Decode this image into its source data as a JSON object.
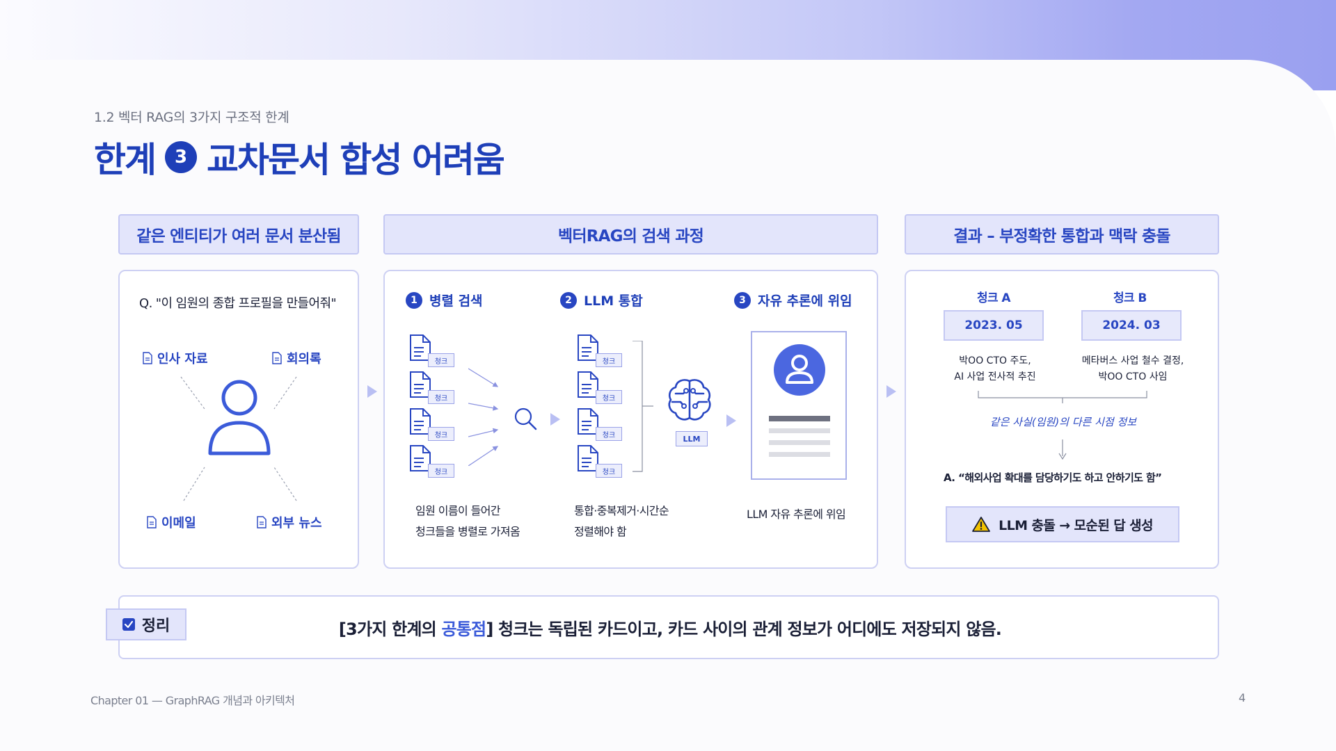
{
  "header": {
    "subtitle": "1.2 벡터 RAG의 3가지 구조적 한계",
    "title_prefix": "한계",
    "title_number": "3",
    "title_text": "교차문서 합성 어려움"
  },
  "columns": {
    "left": {
      "header": "같은 엔티티가 여러 문서 분산됨",
      "question": "Q. \"이 임원의 종합 프로필을 만들어줘\"",
      "sources": [
        "인사 자료",
        "회의록",
        "이메일",
        "외부 뉴스"
      ]
    },
    "middle": {
      "header": "벡터RAG의 검색 과정",
      "steps": [
        {
          "number": "1",
          "label": "병렬 검색",
          "desc_line1": "임원 이름이 들어간",
          "desc_line2": "청크들을 병렬로 가져옴"
        },
        {
          "number": "2",
          "label": "LLM 통합",
          "desc_line1": "통합·중복제거·시간순",
          "desc_line2": "정렬해야 함"
        },
        {
          "number": "3",
          "label": "자유 추론에 위임",
          "desc_line1": "LLM 자유 추론에 위임",
          "desc_line2": ""
        }
      ],
      "chunk_label": "청크",
      "llm_label": "LLM"
    },
    "right": {
      "header": "결과 – 부정확한 통합과 맥락 충돌",
      "chunk_a": {
        "title": "청크 A",
        "date": "2023. 05",
        "line1": "박OO CTO 주도,",
        "line2": "AI 사업 전사적 추진"
      },
      "chunk_b": {
        "title": "청크 B",
        "date": "2024. 03",
        "line1": "메타버스 사업 철수 결정,",
        "line2": "박OO CTO 사임"
      },
      "note": "같은 사실(임원)의 다른 시점 정보",
      "answer": "A. “해외사업  확대를 담당하기도 하고 안하기도 함”",
      "conflict": "LLM 충돌 → 모순된 답 생성"
    }
  },
  "summary": {
    "badge": "정리",
    "text_before": "[3가지 한계의 ",
    "highlight": "공통점",
    "text_after": "] 청크는 독립된 카드이고, 카드 사이의 관계 정보가 어디에도 저장되지 않음."
  },
  "footer": {
    "chapter": "Chapter 01 — GraphRAG 개념과 아키텍처",
    "page": "4"
  },
  "colors": {
    "primary": "#1e3fb8",
    "accent": "#2846c2",
    "highlight": "#3b5bd9",
    "panel_border": "#cdd0f3",
    "header_bg": "#e3e5fb",
    "warning": "#f2c200"
  }
}
